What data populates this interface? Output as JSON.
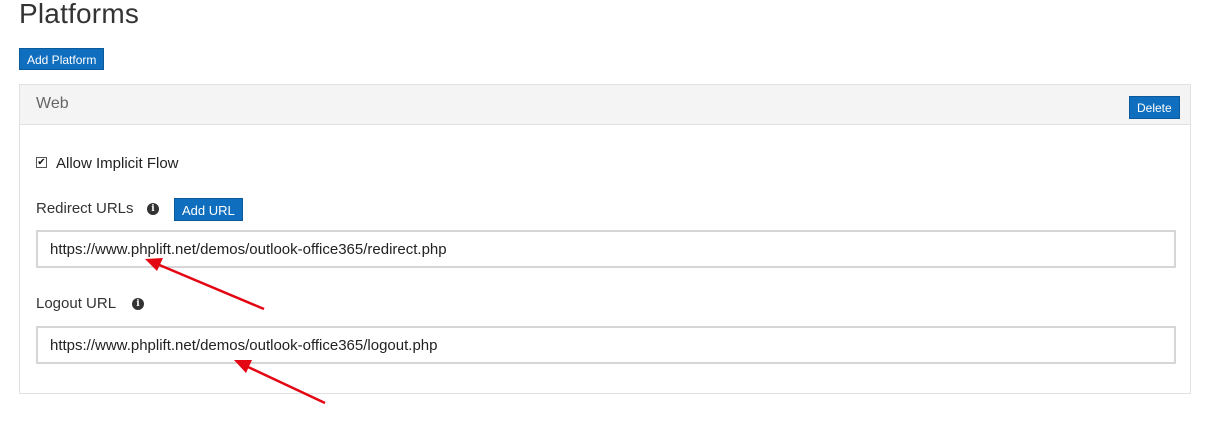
{
  "page": {
    "title": "Platforms",
    "add_platform_label": "Add Platform"
  },
  "platform": {
    "name": "Web",
    "delete_label": "Delete",
    "allow_implicit_flow": {
      "label": "Allow Implicit Flow",
      "checked": true
    },
    "redirect": {
      "label": "Redirect URLs",
      "add_url_label": "Add URL",
      "value": "https://www.phplift.net/demos/outlook-office365/redirect.php"
    },
    "logout": {
      "label": "Logout URL",
      "value": "https://www.phplift.net/demos/outlook-office365/logout.php"
    }
  },
  "icons": {
    "info": "info-icon",
    "check": "checkmark-icon"
  },
  "colors": {
    "accent": "#106ebe",
    "annotation_arrow": "#e30613"
  }
}
